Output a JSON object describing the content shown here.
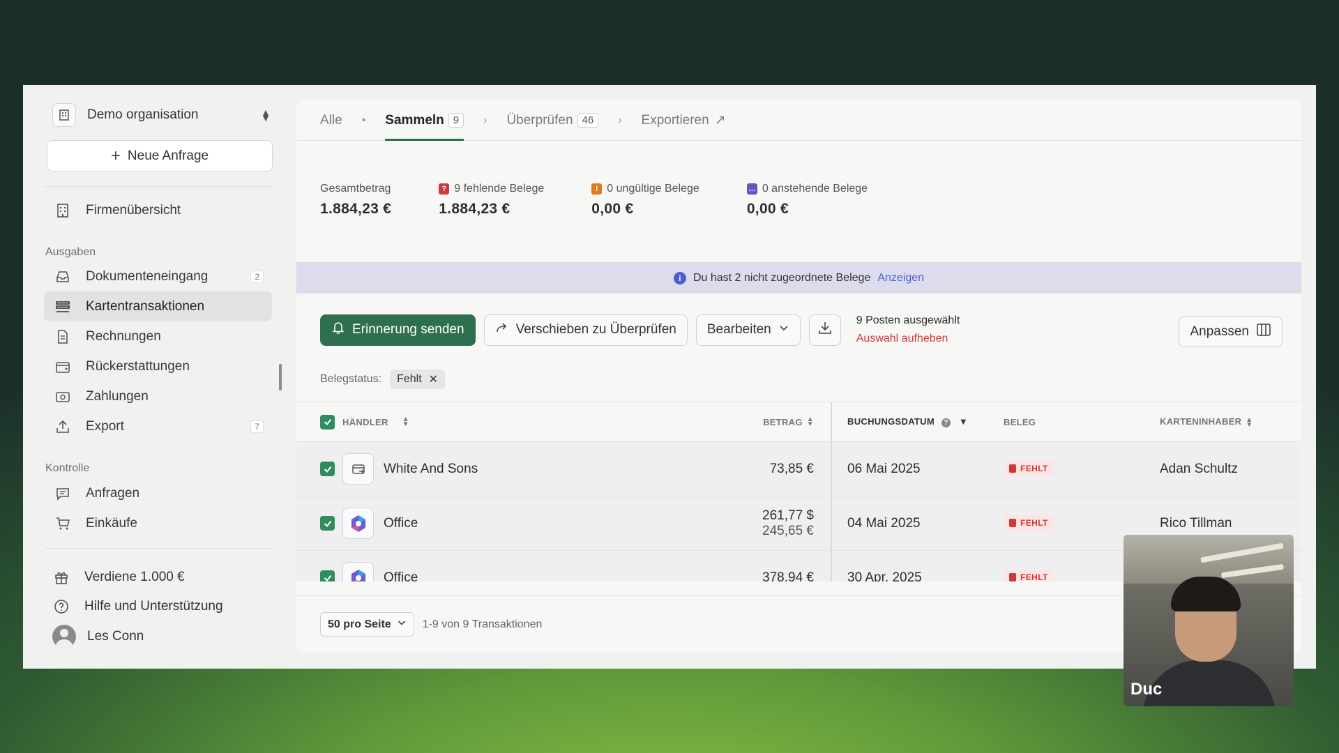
{
  "sidebar": {
    "org_name": "Demo organisation",
    "new_request": "Neue Anfrage",
    "top_item": "Firmenübersicht",
    "section_expenses": "Ausgaben",
    "items": [
      {
        "label": "Dokumenteneingang",
        "badge": "2"
      },
      {
        "label": "Kartentransaktionen",
        "badge": ""
      },
      {
        "label": "Rechnungen",
        "badge": ""
      },
      {
        "label": "Rückerstattungen",
        "badge": ""
      },
      {
        "label": "Zahlungen",
        "badge": ""
      },
      {
        "label": "Export",
        "badge": "7"
      }
    ],
    "section_control": "Kontrolle",
    "control_items": [
      {
        "label": "Anfragen"
      },
      {
        "label": "Einkäufe"
      }
    ],
    "bottom": {
      "earn": "Verdiene 1.000 €",
      "help": "Hilfe und Unterstützung",
      "user": "Les Conn"
    }
  },
  "tabs": {
    "all": "Alle",
    "collect": "Sammeln",
    "collect_count": "9",
    "review": "Überprüfen",
    "review_count": "46",
    "export": "Exportieren"
  },
  "stats": [
    {
      "label": "Gesamtbetrag",
      "value": "1.884,23 €"
    },
    {
      "label": "9 fehlende Belege",
      "value": "1.884,23 €"
    },
    {
      "label": "0 ungültige Belege",
      "value": "0,00 €"
    },
    {
      "label": "0 anstehende Belege",
      "value": "0,00 €"
    }
  ],
  "banner": {
    "text": "Du hast 2 nicht zugeordnete Belege",
    "link": "Anzeigen"
  },
  "actions": {
    "reminder": "Erinnerung senden",
    "move": "Verschieben zu Überprüfen",
    "edit": "Bearbeiten",
    "selected": "9 Posten ausgewählt",
    "clear": "Auswahl aufheben",
    "customize": "Anpassen"
  },
  "filter": {
    "label": "Belegstatus:",
    "chip": "Fehlt"
  },
  "table": {
    "columns": {
      "merchant": "HÄNDLER",
      "amount": "BETRAG",
      "date": "BUCHUNGSDATUM",
      "receipt": "BELEG",
      "holder": "KARTENINHABER"
    },
    "rows": [
      {
        "merchant": "White And Sons",
        "amount": "73,85 €",
        "amount2": "",
        "date": "06 Mai 2025",
        "status": "FEHLT",
        "holder": "Adan Schultz"
      },
      {
        "merchant": "Office",
        "amount": "261,77 $",
        "amount2": "245,65 €",
        "date": "04 Mai 2025",
        "status": "FEHLT",
        "holder": "Rico Tillman"
      },
      {
        "merchant": "Office",
        "amount": "378,94 €",
        "amount2": "",
        "date": "30 Apr. 2025",
        "status": "FEHLT",
        "holder": ""
      }
    ]
  },
  "footer": {
    "per_page": "50 pro Seite",
    "range": "1-9 von 9 Transaktionen"
  },
  "video": {
    "name": "Duc"
  },
  "colors": {
    "primary": "#2f6e4e",
    "danger": "#d03838",
    "info": "#4a5fd0"
  }
}
